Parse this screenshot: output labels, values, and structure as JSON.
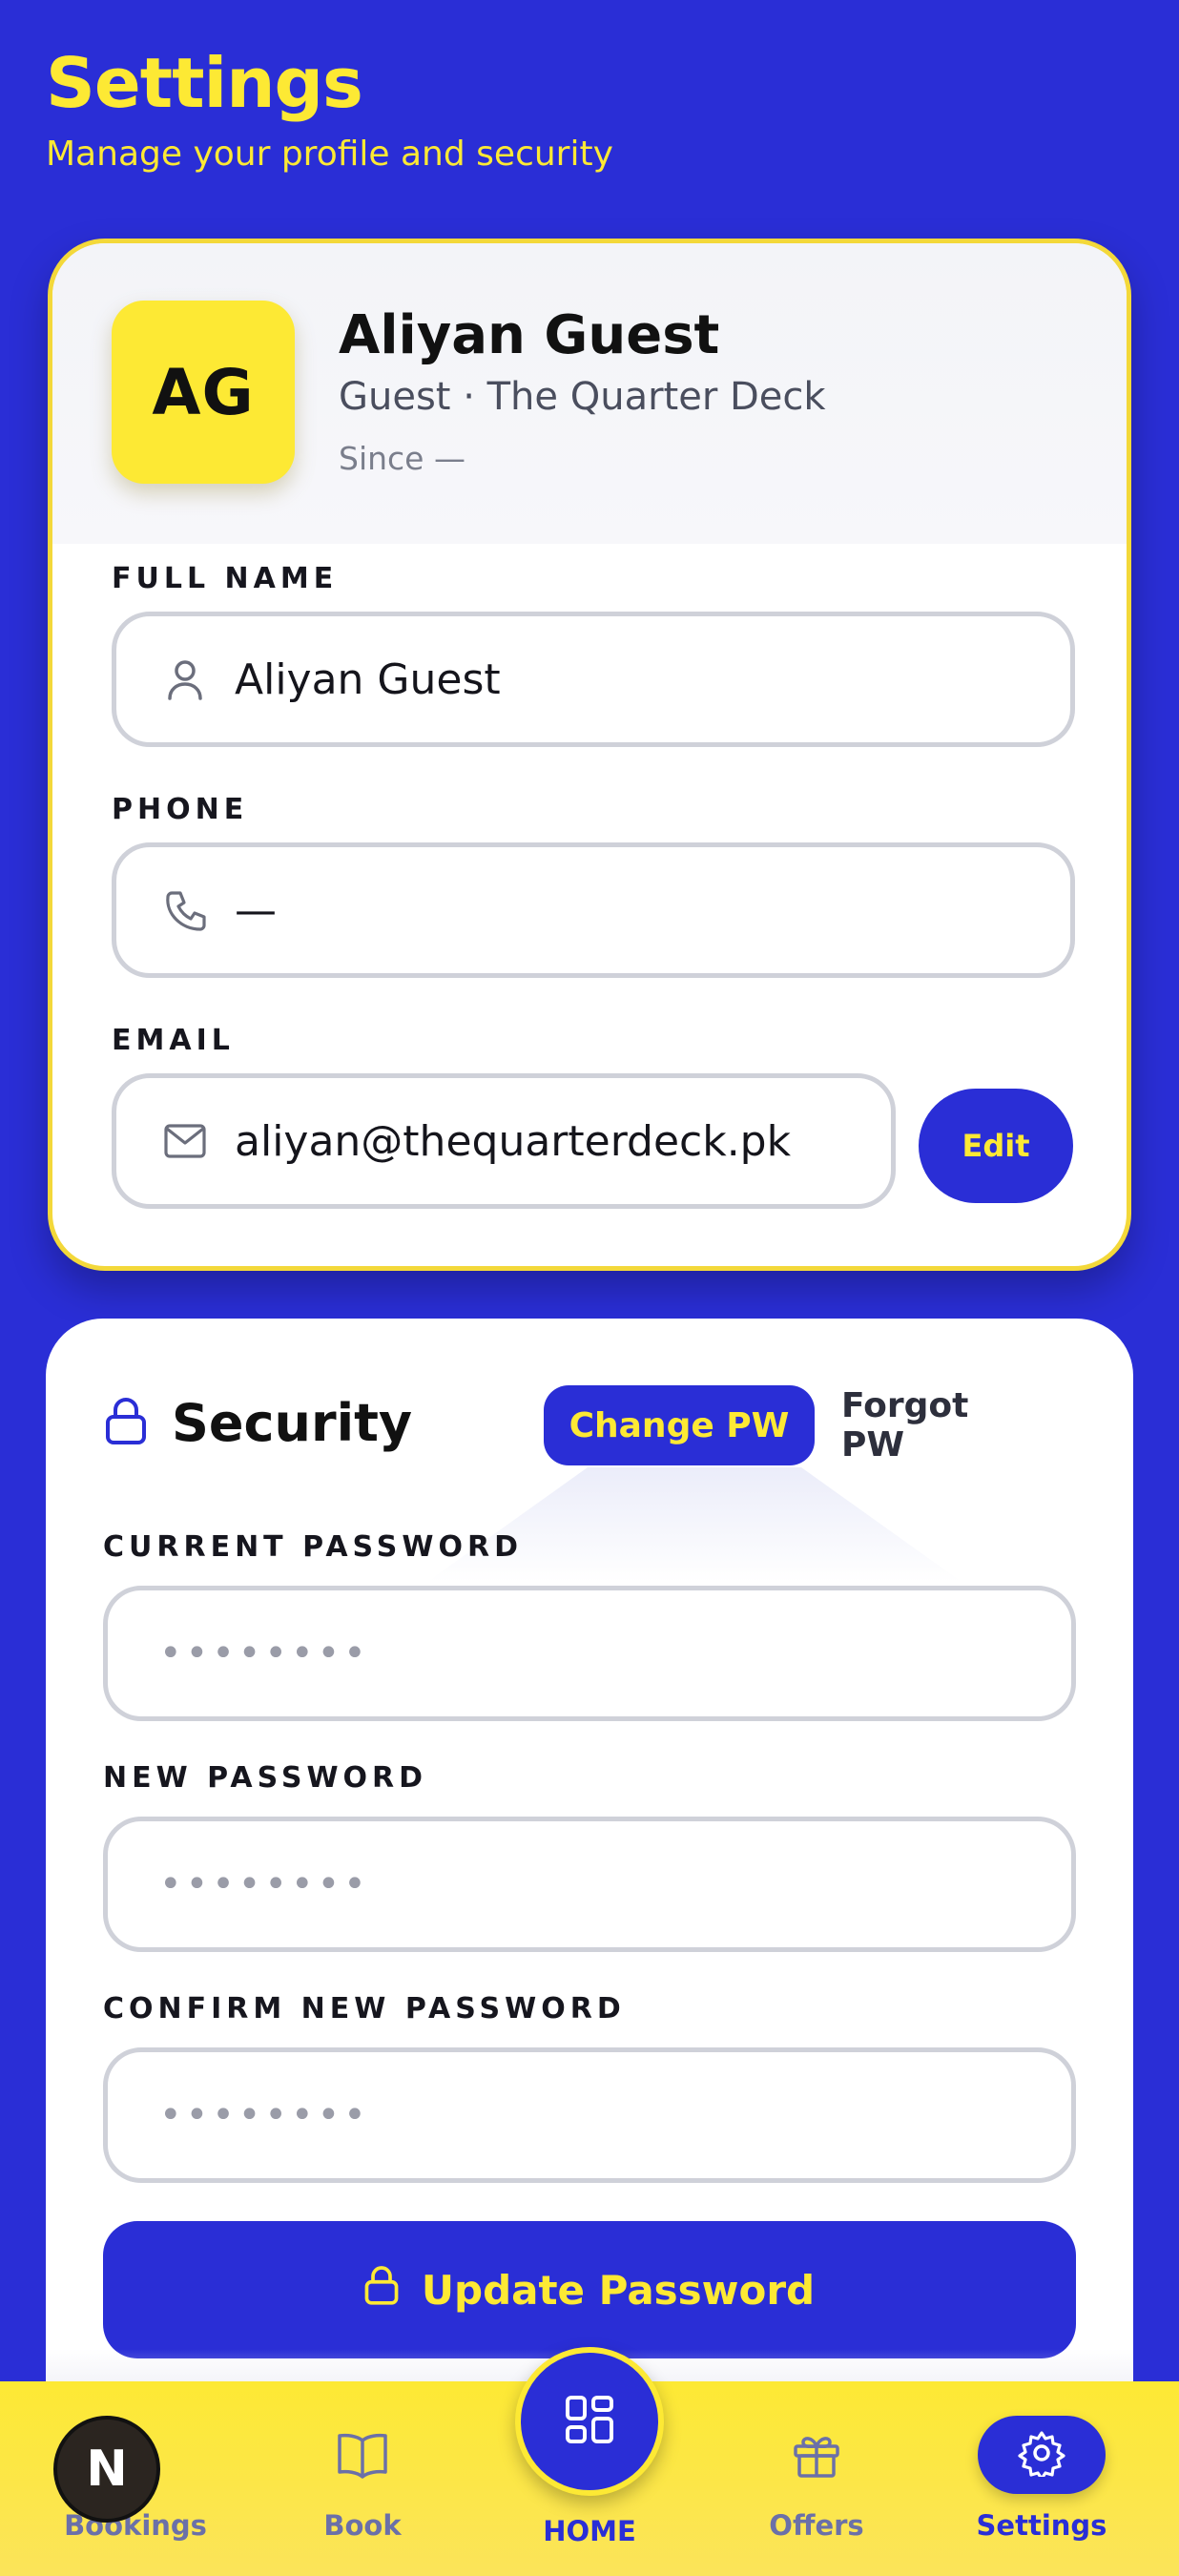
{
  "header": {
    "title": "Settings",
    "subtitle": "Manage your profile and security"
  },
  "profile": {
    "initials": "AG",
    "name": "Aliyan Guest",
    "role": "Guest · The Quarter Deck",
    "since": "Since —",
    "fields": {
      "full_name_label": "FULL NAME",
      "full_name_value": "Aliyan Guest",
      "phone_label": "PHONE",
      "phone_value": "—",
      "email_label": "EMAIL",
      "email_value": "aliyan@thequarterdeck.pk"
    },
    "edit_label": "Edit"
  },
  "security": {
    "title": "Security",
    "tabs": [
      "Change PW",
      "Forgot PW"
    ],
    "active_tab": "Change PW",
    "current_label": "CURRENT PASSWORD",
    "new_label": "NEW PASSWORD",
    "confirm_label": "CONFIRM NEW PASSWORD",
    "placeholder": "••••••••",
    "update_label": "Update Password"
  },
  "nav": {
    "items": [
      "Bookings",
      "Book",
      "HOME",
      "Offers",
      "Settings"
    ],
    "active": "Settings",
    "badge_letter": "N"
  },
  "colors": {
    "background": "#2a2ed6",
    "accent": "#fde934"
  }
}
